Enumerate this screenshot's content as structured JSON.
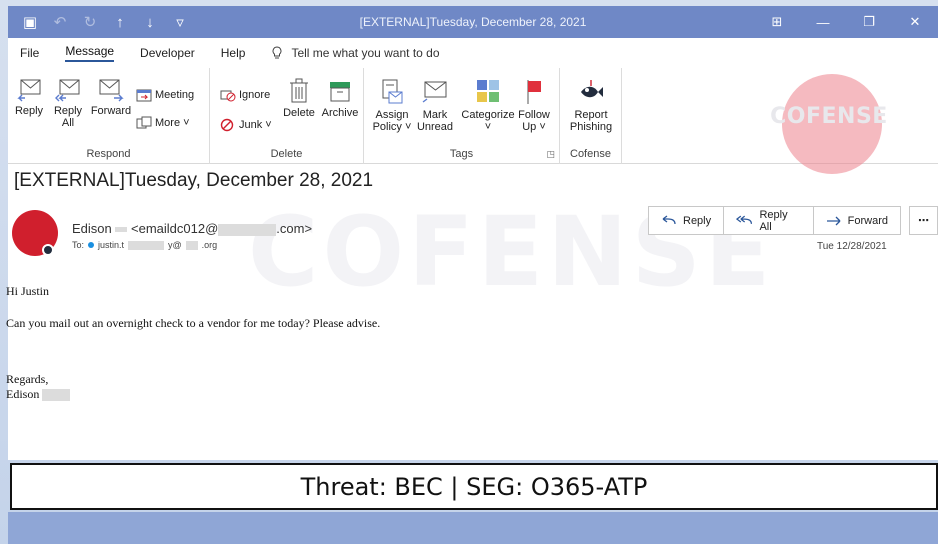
{
  "window": {
    "title": "[EXTERNAL]Tuesday, December 28, 2021",
    "controls": {
      "restore": "⊞",
      "minimize": "—",
      "maximize": "❐",
      "close": "✕"
    }
  },
  "quick_access": {
    "save": "▣",
    "undo": "↶",
    "redo": "↻",
    "up": "↑",
    "down": "↓",
    "customize": "▿"
  },
  "menu": {
    "items": [
      "File",
      "Message",
      "Developer",
      "Help"
    ],
    "active": "Message",
    "tell_me": "Tell me what you want to do"
  },
  "ribbon": {
    "respond": {
      "label": "Respond",
      "reply": "Reply",
      "reply_all_1": "Reply",
      "reply_all_2": "All",
      "forward": "Forward",
      "meeting": "Meeting",
      "more": "More ˅"
    },
    "delete": {
      "label": "Delete",
      "ignore": "Ignore",
      "junk": "Junk ˅",
      "delete": "Delete",
      "archive": "Archive"
    },
    "tags": {
      "label": "Tags",
      "assign_1": "Assign",
      "assign_2": "Policy ˅",
      "mark_1": "Mark",
      "mark_2": "Unread",
      "categorize_1": "Categorize",
      "categorize_2": "˅",
      "follow_1": "Follow",
      "follow_2": "Up ˅",
      "launcher": "◳"
    },
    "cofense": {
      "label": "Cofense",
      "report_1": "Report",
      "report_2": "Phishing"
    }
  },
  "logo": {
    "text": "COFENSE",
    "color": "#e8e8ec"
  },
  "watermark": {
    "text": "COFENSE"
  },
  "message": {
    "subject": "[EXTERNAL]Tuesday, December 28, 2021",
    "sender_name": "Edison",
    "sender_email_prefix": "<emaildc012@",
    "sender_email_suffix": ".com>",
    "to_label": "To:",
    "to_prefix": "justin.t",
    "to_mid": "y@",
    "to_suffix": ".org",
    "date": "Tue 12/28/2021",
    "actions": {
      "reply": "Reply",
      "reply_all": "Reply All",
      "forward": "Forward",
      "more": "⋯"
    },
    "greeting": "Hi Justin",
    "body": "Can you mail out an overnight check to a vendor for me today? Please advise.",
    "closing": "Regards,",
    "signature": "Edison"
  },
  "banner": {
    "text": "Threat: BEC | SEG: O365-ATP"
  },
  "colors": {
    "titlebar": "#6f88c6",
    "avatar": "#d01f2d",
    "accent": "#2b579a",
    "flag": "#e0303c"
  }
}
